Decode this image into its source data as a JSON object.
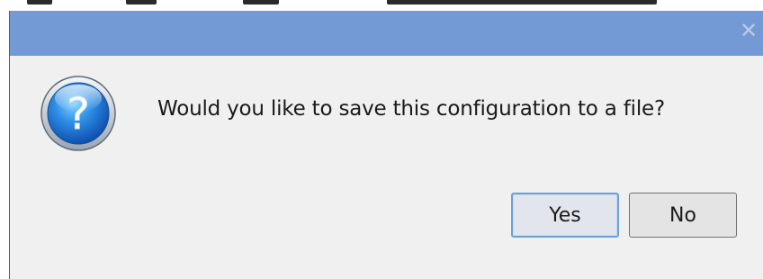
{
  "dialog": {
    "close_glyph": "✕",
    "icon": "question-icon",
    "icon_glyph": "?",
    "message": "Would you like to save this configuration to a file?",
    "buttons": {
      "yes_label": "Yes",
      "no_label": "No"
    }
  },
  "colors": {
    "titlebar": "#739ad4",
    "dialog_bg": "#f0f0f0",
    "default_button_border": "#6aa1d8"
  }
}
